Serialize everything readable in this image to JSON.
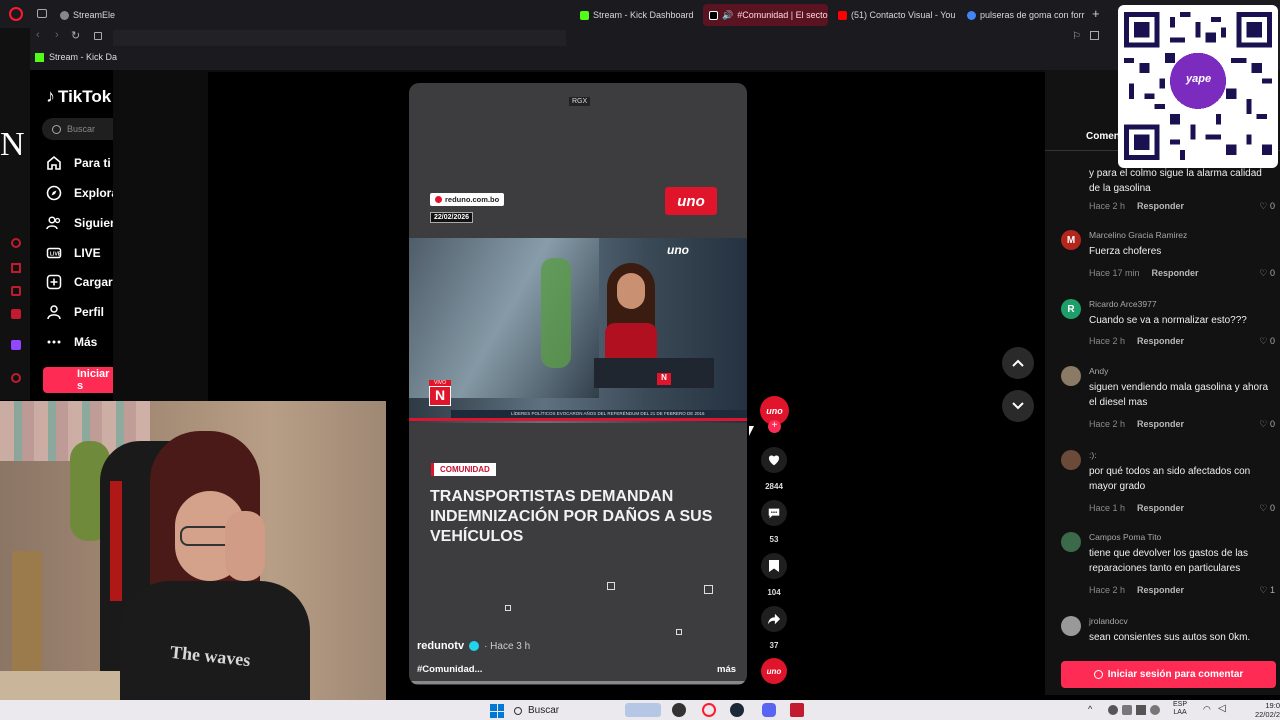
{
  "browser": {
    "tabs": [
      {
        "label": "StreamEle",
        "color": "#888888"
      },
      {
        "label": "Stream - Kick Dashboard",
        "color": "#53fc18"
      },
      {
        "label": "#Comunidad | El secto",
        "color": "#ff2d55"
      },
      {
        "label": "(51) Contacto Visual - You",
        "color": "#ff0000"
      },
      {
        "label": "pulseras de goma con forr",
        "color": "#4285f4"
      }
    ],
    "bookmark": "Stream - Kick Da"
  },
  "tiktok": {
    "logo": "TikTok",
    "search_placeholder": "Buscar",
    "nav": [
      {
        "label": "Para ti",
        "icon": "home-icon"
      },
      {
        "label": "Explorar",
        "icon": "compass-icon"
      },
      {
        "label": "Siguiendo",
        "icon": "users-icon"
      },
      {
        "label": "LIVE",
        "icon": "live-icon"
      },
      {
        "label": "Cargar",
        "icon": "upload-icon"
      },
      {
        "label": "Perfil",
        "icon": "person-icon"
      },
      {
        "label": "Más",
        "icon": "dots-icon"
      }
    ],
    "login_button": "Iniciar s"
  },
  "video": {
    "top_badge": "RGX",
    "source_url": "reduno.com.bo",
    "date": "22/02/2026",
    "channel_logo": "uno",
    "category": "COMUNIDAD",
    "headline": "TRANSPORTISTAS DEMANDAN INDEMNIZACIÓN POR DAÑOS A SUS VEHÍCULOS",
    "author": "redunotv",
    "time": "· Hace 3 h",
    "caption": "#Comunidad...",
    "more": "más",
    "ticker_live": "VIVO",
    "ticker_text": "LÍDERES POLÍTICOS EVOCARON AÑOS DEL REFERÉNDUM DEL 21 DE FEBRERO DE 2016"
  },
  "actions": {
    "likes": "2844",
    "comments": "53",
    "saves": "104",
    "shares": "37"
  },
  "comments_panel": {
    "tab": "Comen",
    "login_button": "Iniciar sesión para comentar",
    "items": [
      {
        "user": "",
        "text": "y para el colmo sigue la alarma calidad de la gasolina",
        "time": "Hace 2 h",
        "reply": "Responder",
        "likes": "0",
        "avatar": "",
        "color": "#444444"
      },
      {
        "user": "Marcelino Gracia Ramirez",
        "text": "Fuerza choferes",
        "time": "Hace 17 min",
        "reply": "Responder",
        "likes": "0",
        "avatar": "M",
        "color": "#b3261e"
      },
      {
        "user": "Ricardo Arce3977",
        "text": "Cuando se va a normalizar esto???",
        "time": "Hace 2 h",
        "reply": "Responder",
        "likes": "0",
        "avatar": "R",
        "color": "#1e9e6a"
      },
      {
        "user": "Andy",
        "text": "siguen vendiendo mala gasolina y ahora el diesel mas",
        "time": "Hace 2 h",
        "reply": "Responder",
        "likes": "0",
        "avatar": "",
        "color": "#8a7a66"
      },
      {
        "user": ":):",
        "text": "por qué todos an sido afectados con mayor grado",
        "time": "Hace 1 h",
        "reply": "Responder",
        "likes": "0",
        "avatar": "",
        "color": "#6b4a3a"
      },
      {
        "user": "Campos Poma Tito",
        "text": "tiene que devolver los gastos de las reparaciones tanto en particulares",
        "time": "Hace 2 h",
        "reply": "Responder",
        "likes": "1",
        "avatar": "",
        "color": "#3a6a4a"
      },
      {
        "user": "jrolandocv",
        "text": "sean consientes sus autos son 0km.",
        "time": "",
        "reply": "",
        "likes": "",
        "avatar": "",
        "color": "#999999"
      }
    ]
  },
  "overlay": {
    "qr_brand": "yape"
  },
  "webcam": {
    "shirt_text": "The waves"
  },
  "taskbar": {
    "search": "Buscar",
    "lang": "ESP",
    "lang2": "LAA",
    "clock": "19:0",
    "date": "22/02/2"
  },
  "colors": {
    "accent": "#fe2c55",
    "kick": "#53fc18",
    "uno_red": "#e0142b"
  }
}
